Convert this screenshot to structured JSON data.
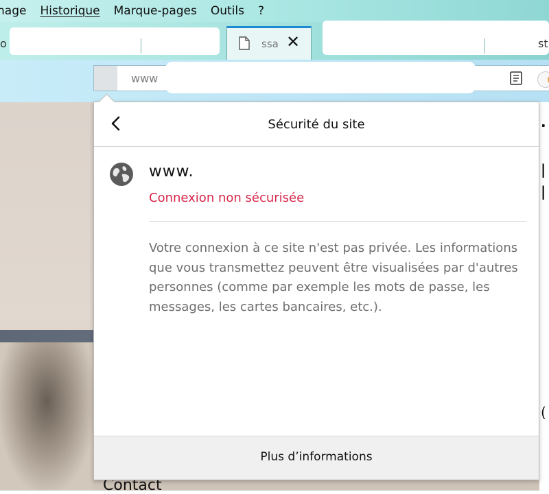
{
  "menubar": {
    "items": [
      "nage",
      "Historique",
      "Marque-pages",
      "Outils",
      "?"
    ]
  },
  "tabs": {
    "left_edge_text": "o",
    "active": {
      "title": "ssa",
      "favicon": "document-icon",
      "close": "✕"
    },
    "right_edge_text": "st"
  },
  "urlbar": {
    "text": "www"
  },
  "panel": {
    "title": "Sécurité du site",
    "host": "www.",
    "connection_status": "Connexion non sécurisée",
    "description": "Votre connexion à ce site n'est pas privée. Les informations que vous transmettez peuvent être visualisées par d'autres personnes (comme par exemple les mots de passe, les messages, les cartes bancaires, etc.).",
    "more_info": "Plus d’informations"
  },
  "page": {
    "contact": "Contact"
  },
  "colors": {
    "warning": "#d7264a",
    "active_tab_accent": "#1b8ad1"
  }
}
